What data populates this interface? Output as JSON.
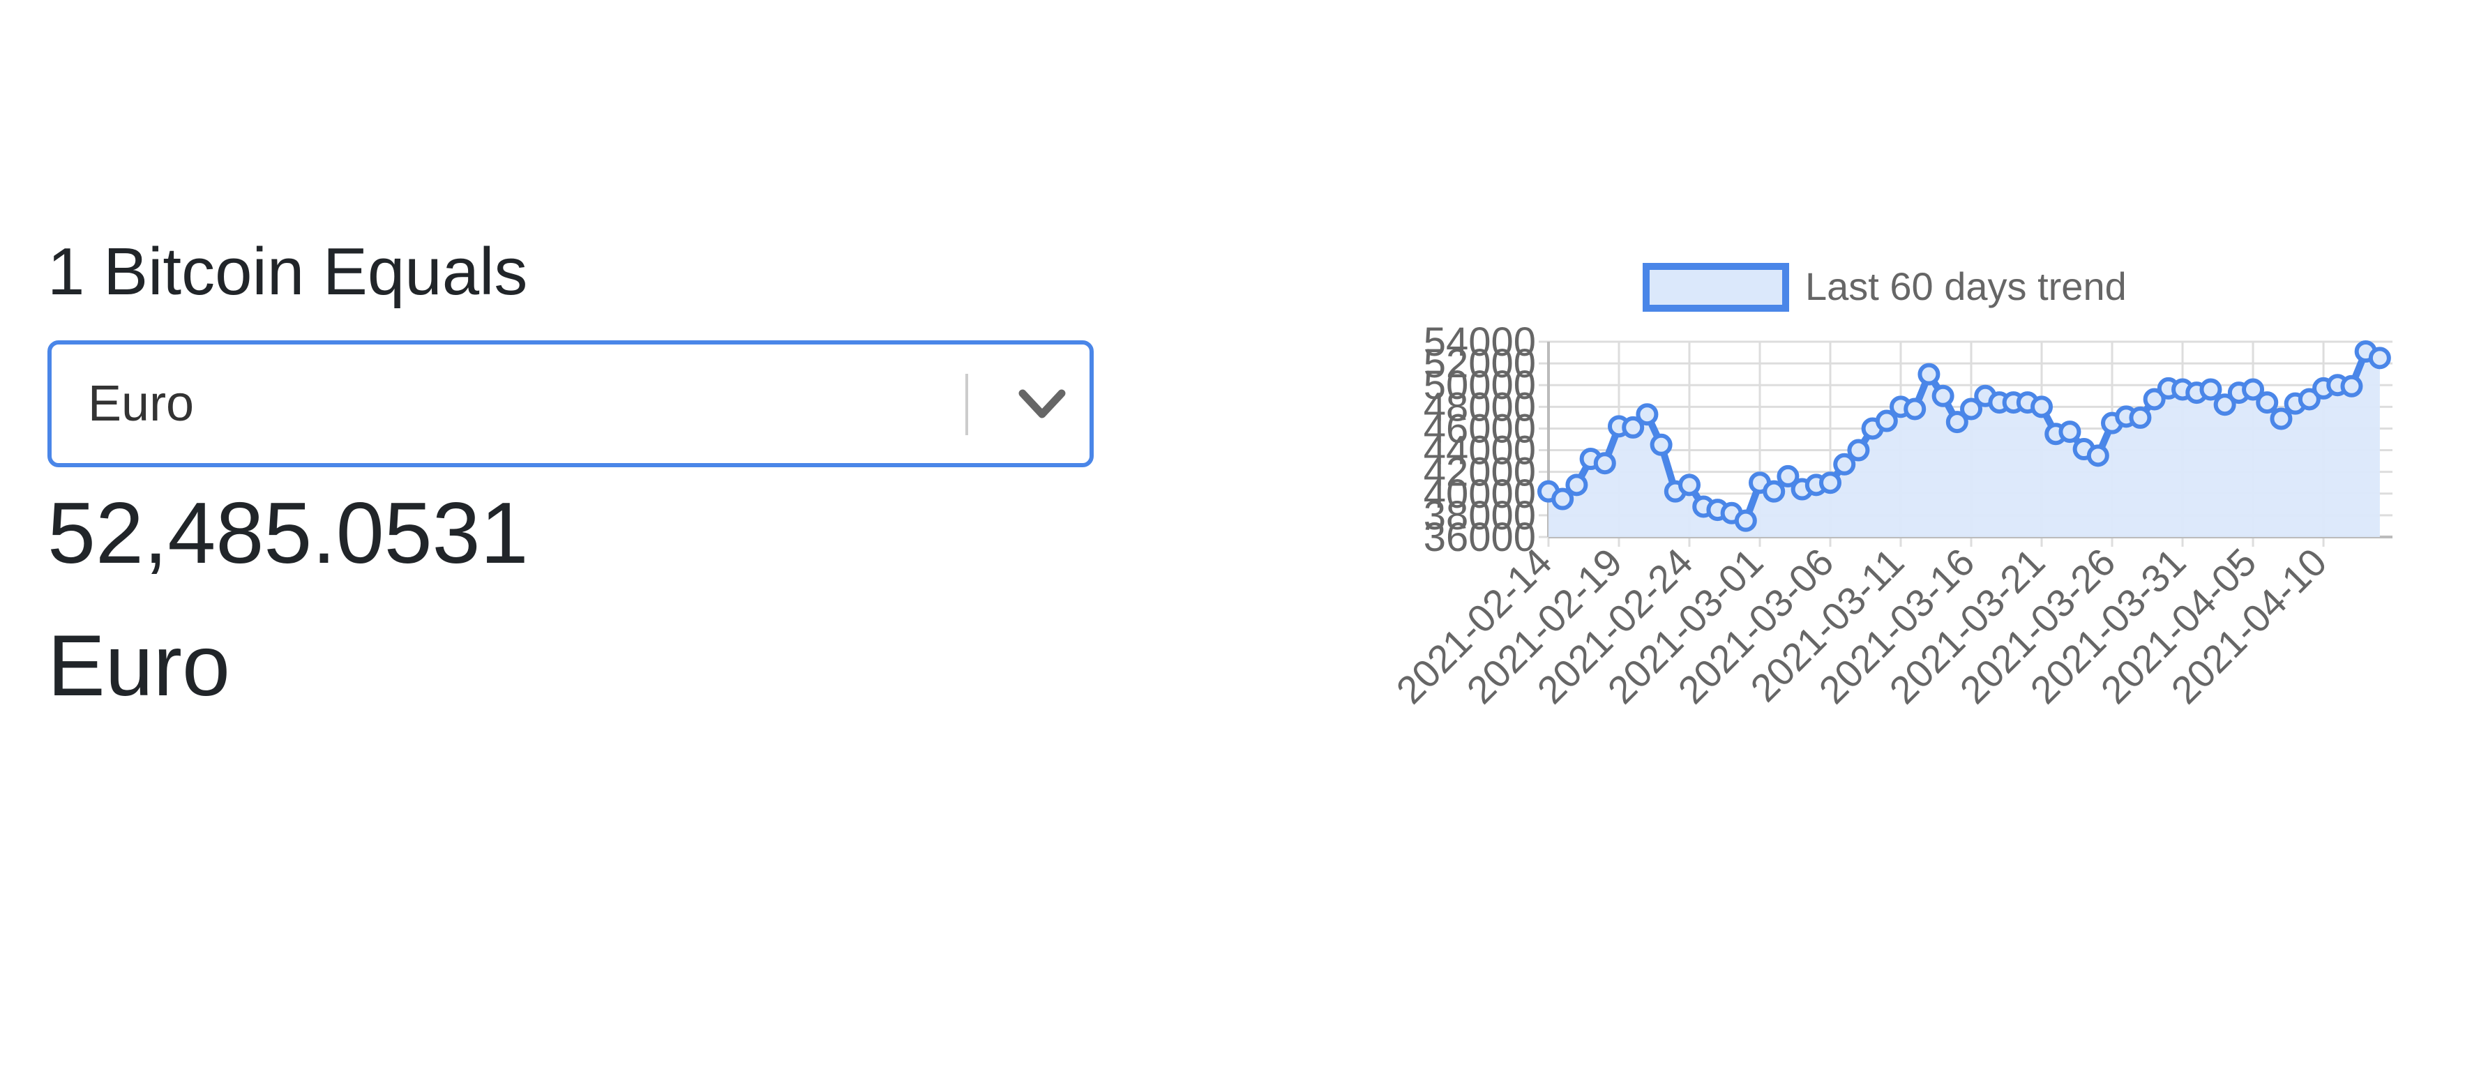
{
  "converter": {
    "heading": "1 Bitcoin Equals",
    "selected_currency": "Euro",
    "amount": "52,485.0531",
    "currency_label": "Euro"
  },
  "icons": {
    "dropdown": "chevron-down-icon"
  },
  "colors": {
    "accent": "#4a86e8",
    "area_fill": "#dbe8fb",
    "text": "#212529",
    "axis_text": "#666666",
    "grid": "#dddddd"
  },
  "chart_data": {
    "type": "area",
    "legend": "Last 60 days trend",
    "legend_position": "top",
    "grid": true,
    "ylim": [
      36000,
      54000
    ],
    "yticks": [
      36000,
      38000,
      40000,
      42000,
      44000,
      46000,
      48000,
      50000,
      52000,
      54000
    ],
    "xtick_labels": [
      "2021-02-14",
      "2021-02-19",
      "2021-02-24",
      "2021-03-01",
      "2021-03-06",
      "2021-03-11",
      "2021-03-16",
      "2021-03-21",
      "2021-03-26",
      "2021-03-31",
      "2021-04-05",
      "2021-04-10"
    ],
    "x": [
      "2021-02-14",
      "2021-02-15",
      "2021-02-16",
      "2021-02-17",
      "2021-02-18",
      "2021-02-19",
      "2021-02-20",
      "2021-02-21",
      "2021-02-22",
      "2021-02-23",
      "2021-02-24",
      "2021-02-25",
      "2021-02-26",
      "2021-02-27",
      "2021-02-28",
      "2021-03-01",
      "2021-03-02",
      "2021-03-03",
      "2021-03-04",
      "2021-03-05",
      "2021-03-06",
      "2021-03-07",
      "2021-03-08",
      "2021-03-09",
      "2021-03-10",
      "2021-03-11",
      "2021-03-12",
      "2021-03-13",
      "2021-03-14",
      "2021-03-15",
      "2021-03-16",
      "2021-03-17",
      "2021-03-18",
      "2021-03-19",
      "2021-03-20",
      "2021-03-21",
      "2021-03-22",
      "2021-03-23",
      "2021-03-24",
      "2021-03-25",
      "2021-03-26",
      "2021-03-27",
      "2021-03-28",
      "2021-03-29",
      "2021-03-30",
      "2021-03-31",
      "2021-04-01",
      "2021-04-02",
      "2021-04-03",
      "2021-04-04",
      "2021-04-05",
      "2021-04-06",
      "2021-04-07",
      "2021-04-08",
      "2021-04-09",
      "2021-04-10",
      "2021-04-11",
      "2021-04-12",
      "2021-04-13",
      "2021-04-14"
    ],
    "series": [
      {
        "name": "Last 60 days trend",
        "values": [
          40200,
          39500,
          40800,
          43200,
          42800,
          46200,
          46100,
          47300,
          44500,
          40200,
          40800,
          38800,
          38500,
          38200,
          37500,
          41000,
          40200,
          41600,
          40400,
          40800,
          41000,
          42700,
          44000,
          46000,
          46700,
          48000,
          47800,
          51000,
          49000,
          46600,
          47800,
          49000,
          48400,
          48400,
          48400,
          48000,
          45500,
          45700,
          44100,
          43500,
          46500,
          47100,
          47000,
          48700,
          49700,
          49600,
          49300,
          49600,
          48200,
          49300,
          49600,
          48400,
          46900,
          48300,
          48700,
          49700,
          50000,
          49900,
          53100,
          52500
        ]
      }
    ]
  }
}
